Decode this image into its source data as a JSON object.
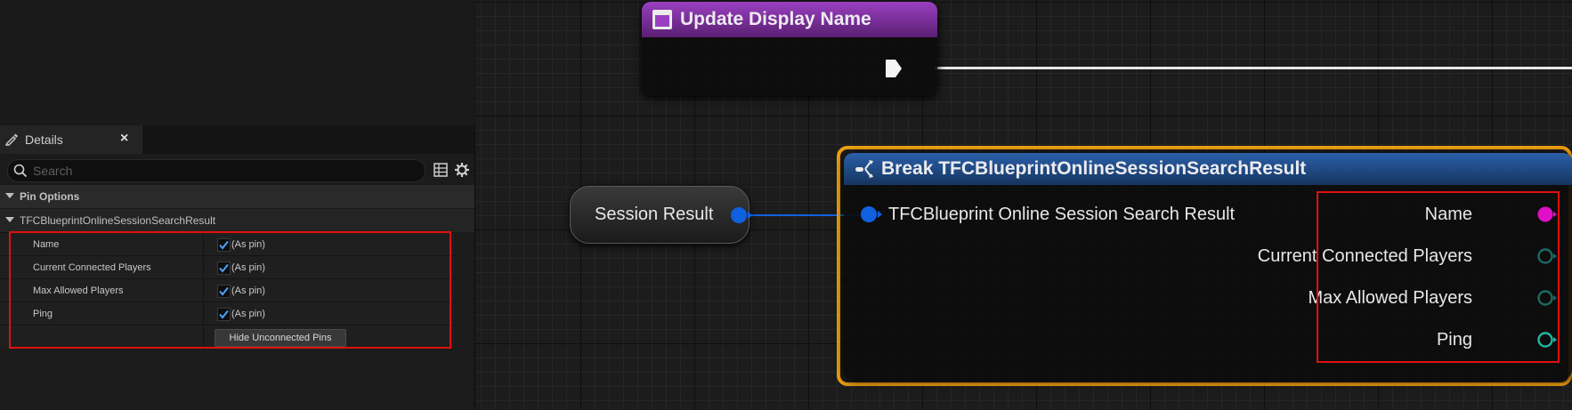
{
  "details_panel": {
    "tab_label": "Details",
    "close_glyph": "×",
    "search_placeholder": "Search",
    "section_pin_options": "Pin Options",
    "section_struct": "TFCBlueprintOnlineSessionSearchResult",
    "rows": [
      {
        "name": "Name",
        "value": "(As pin)",
        "checked": true
      },
      {
        "name": "Current Connected Players",
        "value": "(As pin)",
        "checked": true
      },
      {
        "name": "Max Allowed Players",
        "value": "(As pin)",
        "checked": true
      },
      {
        "name": "Ping",
        "value": "(As pin)",
        "checked": true
      }
    ],
    "hide_button": "Hide Unconnected Pins"
  },
  "graph": {
    "event_node": {
      "title": "Update Display Name"
    },
    "variable_node": {
      "label": "Session Result"
    },
    "break_node": {
      "title": "Break TFCBlueprintOnlineSessionSearchResult",
      "input_pin": "TFCBlueprint Online Session Search Result",
      "output_pins": [
        "Name",
        "Current Connected Players",
        "Max Allowed Players",
        "Ping"
      ]
    }
  },
  "colors": {
    "struct_pin": "#1060e0",
    "string_pin": "#e010c8",
    "int_pin": "#1a6b62",
    "int_pin_bright": "#20b8a0",
    "highlight": "#e0101a",
    "selection": "#f0a010",
    "event_header": "#7a2e9a",
    "break_header": "#1e4a86"
  }
}
